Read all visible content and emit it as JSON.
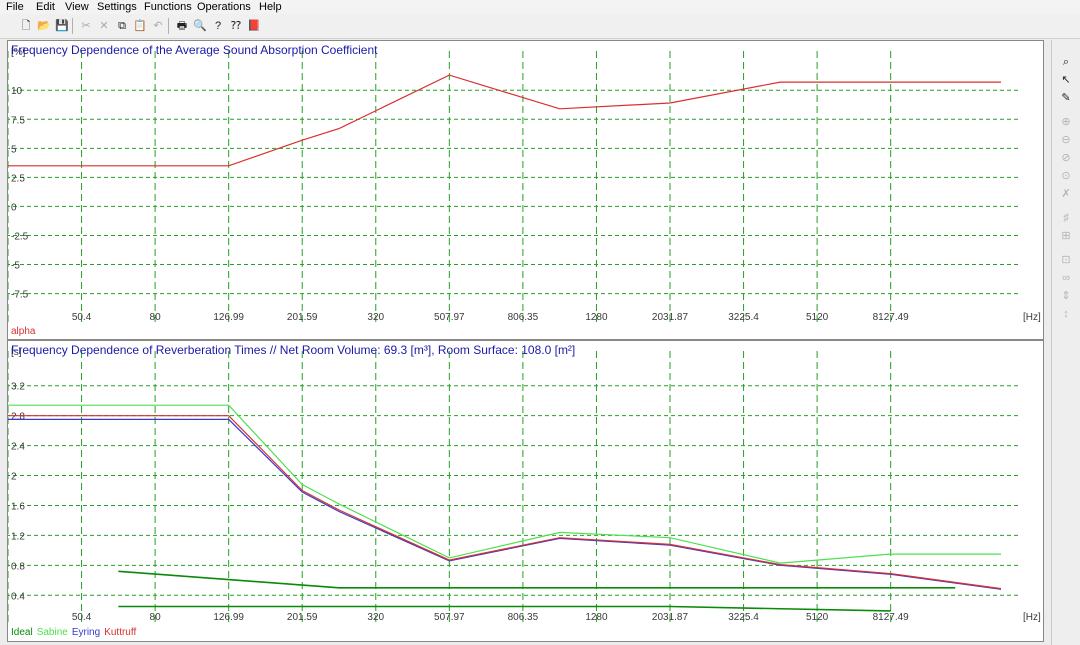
{
  "menu": [
    "File",
    "Edit",
    "View",
    "Settings",
    "Functions",
    "Operations",
    "Help"
  ],
  "toolbar": [
    {
      "icon": "new-file-icon",
      "glyph": "🗋"
    },
    {
      "icon": "open-folder-icon",
      "glyph": "📂"
    },
    {
      "icon": "save-icon",
      "glyph": "💾"
    },
    {
      "icon": "cut-icon",
      "glyph": "✂",
      "disabled": true
    },
    {
      "icon": "delete-icon",
      "glyph": "✕",
      "disabled": true
    },
    {
      "icon": "copy-icon",
      "glyph": "⧉"
    },
    {
      "icon": "paste-icon",
      "glyph": "📋"
    },
    {
      "icon": "undo-icon",
      "glyph": "↶",
      "disabled": true
    },
    {
      "icon": "print-icon",
      "glyph": "🖶"
    },
    {
      "icon": "print-preview-icon",
      "glyph": "🔍"
    },
    {
      "icon": "help-icon",
      "glyph": "?"
    },
    {
      "icon": "context-help-icon",
      "glyph": "⁇"
    },
    {
      "icon": "book-icon",
      "glyph": "📕"
    }
  ],
  "right_tools": [
    {
      "icon": "magnify-icon",
      "glyph": "⌕",
      "active": true
    },
    {
      "icon": "pointer-icon",
      "glyph": "↖",
      "active": true
    },
    {
      "icon": "pencil-icon",
      "glyph": "✎",
      "active": true
    },
    {
      "icon": "zoom-in-icon",
      "glyph": "⊕"
    },
    {
      "icon": "zoom-out-icon",
      "glyph": "⊖"
    },
    {
      "icon": "zoom-x-icon",
      "glyph": "⊘"
    },
    {
      "icon": "zoom-fit-icon",
      "glyph": "⊙"
    },
    {
      "icon": "crosshair-off-icon",
      "glyph": "✗"
    },
    {
      "icon": "grid-icon",
      "glyph": "♯"
    },
    {
      "icon": "grid-scale-icon",
      "glyph": "⊞"
    },
    {
      "icon": "export-image-icon",
      "glyph": "⊡"
    },
    {
      "icon": "loop-icon",
      "glyph": "∞"
    },
    {
      "icon": "vertical-scale-icon",
      "glyph": "⇕"
    },
    {
      "icon": "vertical-fit-icon",
      "glyph": "↕"
    }
  ],
  "chart_data": [
    {
      "type": "line",
      "title": "Frequency Dependence of the Average Sound Absorption Coefficient",
      "yunit": "[%]",
      "xunit": "[Hz]",
      "x_tick_labels": [
        "50.4",
        "80",
        "126.99",
        "201.59",
        "320",
        "507.97",
        "806.35",
        "1280",
        "2031.87",
        "3225.4",
        "5120",
        "8127.49"
      ],
      "y_ticks": [
        "10",
        "7.5",
        "5",
        "2.5",
        "0",
        "-2.5",
        "-5",
        "-7.5"
      ],
      "ylim": [
        -9,
        12
      ],
      "log_x": true,
      "grid": true,
      "series": [
        {
          "name": "alpha",
          "color": "#d8302f",
          "points": [
            [
              31.75,
              3.5
            ],
            [
              126.99,
              3.5
            ],
            [
              201.59,
              5.7
            ],
            [
              254,
              6.7
            ],
            [
              507.97,
              11.3
            ],
            [
              1016,
              8.4
            ],
            [
              2031.87,
              8.9
            ],
            [
              4064,
              10.7
            ],
            [
              16255,
              10.7
            ]
          ]
        }
      ]
    },
    {
      "type": "line",
      "title": "Frequency Dependence of Reverberation Times // Net Room Volume: 69.3 [m³], Room Surface: 108.0 [m²]",
      "yunit": "[s]",
      "xunit": "[Hz]",
      "x_tick_labels": [
        "50.4",
        "80",
        "126.99",
        "201.59",
        "320",
        "507.97",
        "806.35",
        "1280",
        "2031.87",
        "3225.4",
        "5120",
        "8127.49"
      ],
      "y_ticks": [
        "3.2",
        "2.8",
        "2.4",
        "2",
        "1.6",
        "1.2",
        "0.8",
        "0.4"
      ],
      "ylim": [
        0.15,
        3.45
      ],
      "log_x": true,
      "grid": true,
      "series": [
        {
          "name": "Ideal",
          "color": "#0a8a0a",
          "points": [
            [
              63.5,
              0.72
            ],
            [
              254,
              0.5
            ],
            [
              12192,
              0.5
            ]
          ]
        },
        {
          "name": "Ideal",
          "color": "#0a8a0a",
          "points": [
            [
              63.5,
              0.25
            ],
            [
              2031.87,
              0.25
            ],
            [
              8127.49,
              0.19
            ]
          ]
        },
        {
          "name": "Sabine",
          "color": "#4ee04e",
          "points": [
            [
              31.75,
              2.94
            ],
            [
              126.99,
              2.94
            ],
            [
              201.59,
              1.88
            ],
            [
              254,
              1.62
            ],
            [
              507.97,
              0.9
            ],
            [
              1016,
              1.24
            ],
            [
              2031.87,
              1.17
            ],
            [
              4064,
              0.83
            ],
            [
              8127.49,
              0.95
            ],
            [
              16255,
              0.95
            ]
          ]
        },
        {
          "name": "Eyring",
          "color": "#3a3ad0",
          "points": [
            [
              31.75,
              2.75
            ],
            [
              126.99,
              2.75
            ],
            [
              201.59,
              1.78
            ],
            [
              254,
              1.52
            ],
            [
              507.97,
              0.86
            ],
            [
              1016,
              1.16
            ],
            [
              2031.87,
              1.07
            ],
            [
              4064,
              0.8
            ],
            [
              8127.49,
              0.68
            ],
            [
              16255,
              0.48
            ]
          ]
        },
        {
          "name": "Kuttruff",
          "color": "#d8302f",
          "points": [
            [
              31.75,
              2.8
            ],
            [
              126.99,
              2.8
            ],
            [
              201.59,
              1.8
            ],
            [
              254,
              1.54
            ],
            [
              507.97,
              0.87
            ],
            [
              1016,
              1.17
            ],
            [
              2031.87,
              1.08
            ],
            [
              4064,
              0.81
            ],
            [
              8127.49,
              0.69
            ],
            [
              16255,
              0.49
            ]
          ]
        }
      ]
    }
  ],
  "legend1": [
    {
      "label": "alpha",
      "color": "#d8302f"
    }
  ],
  "legend2": [
    {
      "label": "Ideal",
      "color": "#0a8a0a"
    },
    {
      "label": "Sabine",
      "color": "#4ee04e"
    },
    {
      "label": "Eyring",
      "color": "#3a3ad0"
    },
    {
      "label": "Kuttruff",
      "color": "#d8302f"
    }
  ]
}
